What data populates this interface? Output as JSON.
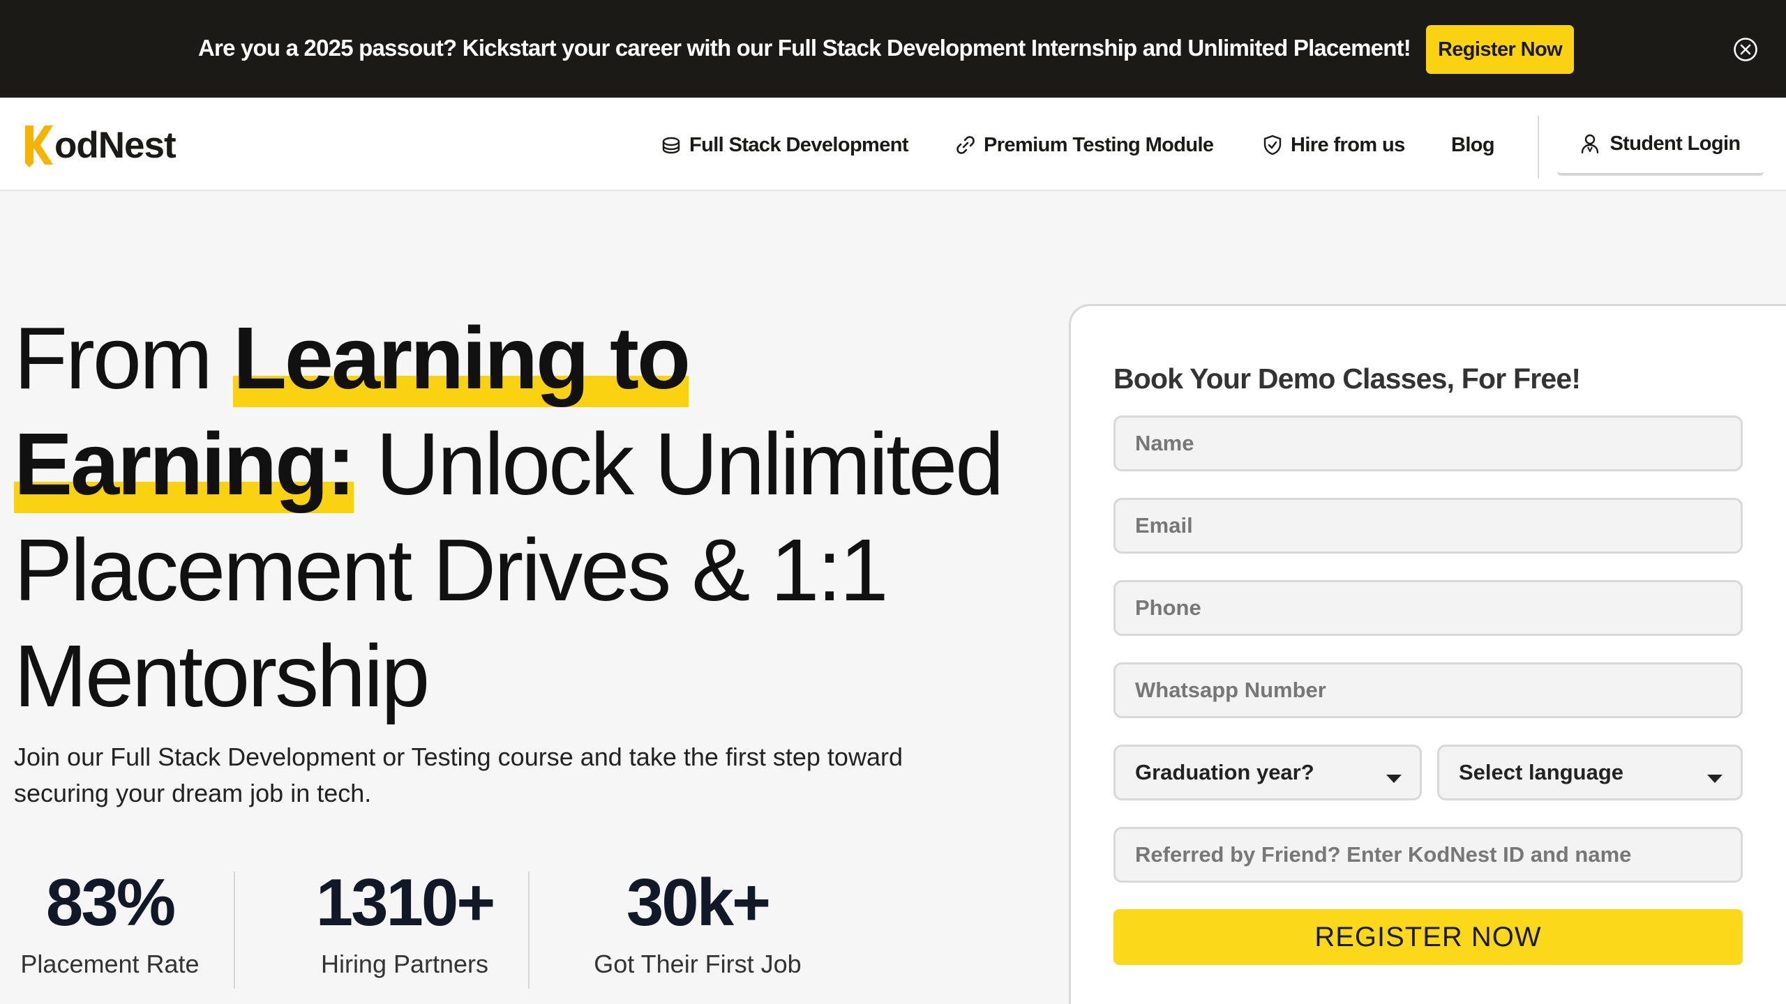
{
  "banner": {
    "text": "Are you a 2025 passout? Kickstart your career with our Full Stack Development Internship and Unlimited Placement!",
    "button": "Register Now",
    "close_icon": "close-circle-icon"
  },
  "nav": {
    "logo_text": "odNest",
    "logo_letter": "K",
    "items": [
      {
        "label": "Full Stack Development",
        "icon": "stack-icon"
      },
      {
        "label": "Premium Testing Module",
        "icon": "link-icon"
      },
      {
        "label": "Hire from us",
        "icon": "shield-icon"
      },
      {
        "label": "Blog"
      }
    ],
    "login": {
      "label": "Student Login",
      "icon": "user-icon"
    }
  },
  "hero": {
    "title_part1": "From ",
    "title_hl1": "Learning to",
    "title_hl2": "Earning:",
    "title_part2": " Unlock Unlimited Placement Drives & 1:1 Mentorship",
    "subtitle": "Join our Full Stack Development or Testing course and take the first step toward securing your dream job in tech.",
    "stats": [
      {
        "value": "83%",
        "label": "Placement Rate"
      },
      {
        "value": "1310+",
        "label": "Hiring Partners"
      },
      {
        "value": "30k+",
        "label": "Got Their First Job"
      }
    ]
  },
  "form": {
    "title": "Book Your Demo Classes, For Free!",
    "name_placeholder": "Name",
    "email_placeholder": "Email",
    "phone_placeholder": "Phone",
    "whatsapp_placeholder": "Whatsapp Number",
    "graduation_select": "Graduation year?",
    "language_select": "Select language",
    "referral_placeholder": "Referred by Friend? Enter KodNest ID and name",
    "submit": "REGISTER NOW"
  },
  "colors": {
    "accent": "#fbd20f",
    "banner_bg": "#1c1a17",
    "page_bg": "#f6f6f6"
  }
}
